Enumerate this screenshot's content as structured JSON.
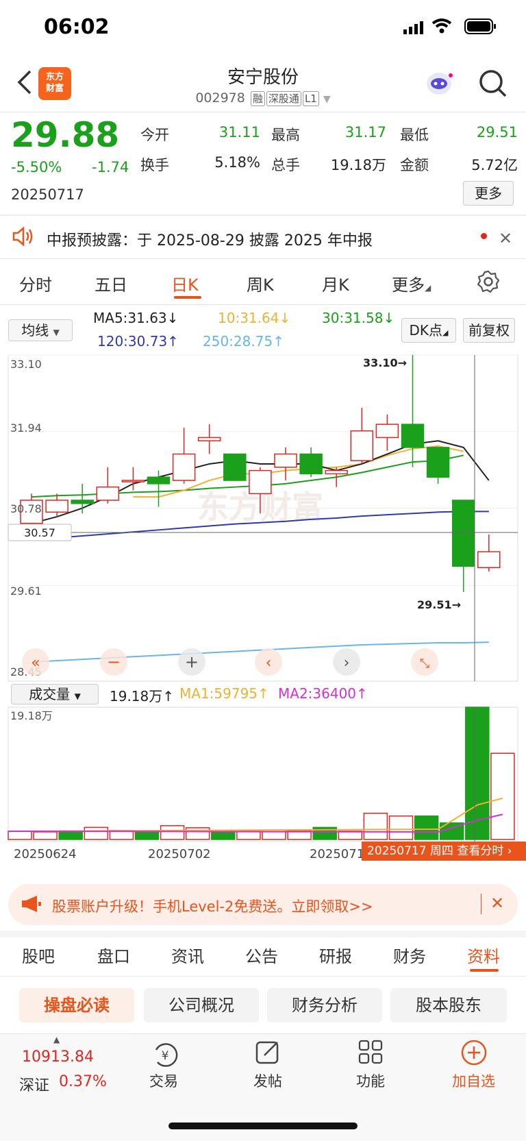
{
  "status_bar": {
    "time": "06:02"
  },
  "header": {
    "logo_text_1": "东方",
    "logo_text_2": "财富",
    "stock_name": "安宁股份",
    "code": "002978",
    "tags": [
      "融",
      "深股通",
      "L1"
    ]
  },
  "quote": {
    "price": "29.88",
    "change_pct": "-5.50%",
    "change": "-1.74",
    "date": "20250717",
    "open_label": "今开",
    "open": "31.11",
    "high_label": "最高",
    "high": "31.17",
    "low_label": "最低",
    "low": "29.51",
    "turnover_label": "换手",
    "turnover": "5.18%",
    "volume_label": "总手",
    "volume": "19.18万",
    "amount_label": "金额",
    "amount": "5.72亿",
    "more_label": "更多"
  },
  "notice": {
    "text": "中报预披露：于 2025-08-29 披露 2025 年中报"
  },
  "period_tabs": [
    "分时",
    "五日",
    "日K",
    "周K",
    "月K",
    "更多"
  ],
  "active_period": "日K",
  "indicators": {
    "ma_select": "均线",
    "ma5": "MA5:31.63↓",
    "ma10": "10:31.64↓",
    "ma30": "30:31.58↓",
    "ma120": "120:30.73↑",
    "ma250": "250:28.75↑",
    "dk_label": "DK点",
    "adjust_label": "前复权"
  },
  "price_axis": [
    "33.10",
    "31.94",
    "30.78",
    "29.61",
    "28.45"
  ],
  "crosshair_price": "30.57",
  "high_marker": "33.10→",
  "low_marker": "29.51→",
  "watermark": "东方财富",
  "volume_panel": {
    "select": "成交量",
    "value": "19.18万↑",
    "ma1": "MA1:59795↑",
    "ma2": "MA2:36400↑",
    "axis_top": "19.18万"
  },
  "date_axis": [
    "20250624",
    "20250702",
    "20250710"
  ],
  "tooltip": "20250717 周四  查看分时",
  "colors": {
    "up": "#e0261f",
    "down": "#1aa01a",
    "accent": "#e8541c"
  },
  "chart_data": {
    "type": "candlestick",
    "ylim": [
      28.45,
      33.1
    ],
    "candles": [
      {
        "o": 30.55,
        "c": 30.9,
        "h": 31.0,
        "l": 30.45
      },
      {
        "o": 30.72,
        "c": 30.9,
        "h": 31.0,
        "l": 30.65
      },
      {
        "o": 30.9,
        "c": 30.85,
        "h": 31.15,
        "l": 30.7
      },
      {
        "o": 30.9,
        "c": 31.1,
        "h": 31.4,
        "l": 30.85
      },
      {
        "o": 31.2,
        "c": 31.2,
        "h": 31.4,
        "l": 31.05
      },
      {
        "o": 31.25,
        "c": 31.15,
        "h": 31.35,
        "l": 30.8
      },
      {
        "o": 31.2,
        "c": 31.6,
        "h": 32.0,
        "l": 31.15
      },
      {
        "o": 31.8,
        "c": 31.85,
        "h": 32.05,
        "l": 31.6
      },
      {
        "o": 31.6,
        "c": 31.2,
        "h": 31.6,
        "l": 31.2
      },
      {
        "o": 31.0,
        "c": 31.35,
        "h": 31.4,
        "l": 30.7
      },
      {
        "o": 31.4,
        "c": 31.6,
        "h": 31.7,
        "l": 31.2
      },
      {
        "o": 31.6,
        "c": 31.3,
        "h": 31.7,
        "l": 31.25
      },
      {
        "o": 31.3,
        "c": 31.35,
        "h": 31.4,
        "l": 31.1
      },
      {
        "o": 31.5,
        "c": 31.95,
        "h": 32.3,
        "l": 31.45
      },
      {
        "o": 31.85,
        "c": 32.05,
        "h": 32.2,
        "l": 31.65
      },
      {
        "o": 32.05,
        "c": 31.7,
        "h": 33.1,
        "l": 31.4
      },
      {
        "o": 31.7,
        "c": 31.25,
        "h": 31.7,
        "l": 31.15
      },
      {
        "o": 30.9,
        "c": 29.9,
        "h": 30.9,
        "l": 29.51
      },
      {
        "o": 29.88,
        "c": 30.12,
        "h": 30.38,
        "l": 29.82
      }
    ],
    "ma5": [
      30.55,
      30.65,
      30.78,
      30.95,
      31.15,
      31.25,
      31.35,
      31.45,
      31.5,
      31.45,
      31.45,
      31.45,
      31.35,
      31.45,
      31.6,
      31.75,
      31.8,
      31.7,
      31.2
    ],
    "ma10": [
      null,
      null,
      null,
      null,
      30.95,
      30.95,
      31.05,
      31.2,
      31.3,
      31.3,
      31.35,
      31.38,
      31.4,
      31.45,
      31.58,
      31.68,
      31.72,
      31.64
    ],
    "ma30": [
      30.95,
      30.97,
      30.98,
      31.0,
      31.02,
      31.03,
      31.05,
      31.08,
      31.1,
      31.12,
      31.15,
      31.2,
      31.25,
      31.32,
      31.4,
      31.48,
      31.5,
      31.58
    ],
    "ma120": [
      30.3,
      30.33,
      30.36,
      30.39,
      30.42,
      30.45,
      30.48,
      30.51,
      30.54,
      30.56,
      30.58,
      30.61,
      30.63,
      30.66,
      30.68,
      30.7,
      30.72,
      30.73,
      30.73
    ],
    "ma250": [
      28.45,
      28.47,
      28.49,
      28.51,
      28.53,
      28.55,
      28.57,
      28.59,
      28.61,
      28.63,
      28.65,
      28.67,
      28.69,
      28.71,
      28.72,
      28.73,
      28.74,
      28.74,
      28.75
    ],
    "volume_max": 191800,
    "volumes": [
      12000,
      11000,
      12500,
      17500,
      13000,
      12000,
      20000,
      17000,
      13000,
      12000,
      13500,
      13000,
      17500,
      12000,
      38000,
      34000,
      34000,
      24000,
      191800,
      125000
    ],
    "vol_ma1": [
      null,
      null,
      null,
      null,
      null,
      null,
      null,
      null,
      null,
      null,
      null,
      null,
      null,
      null,
      null,
      null,
      null,
      null,
      50000,
      59795
    ],
    "vol_ma2": [
      null,
      null,
      null,
      null,
      null,
      null,
      null,
      null,
      null,
      null,
      null,
      null,
      null,
      null,
      null,
      null,
      null,
      null,
      28000,
      36400
    ]
  },
  "promo": {
    "text": "股票账户升级！手机Level-2免费送。立即领取>>"
  },
  "section_tabs": [
    "股吧",
    "盘口",
    "资讯",
    "公告",
    "研报",
    "财务",
    "资料"
  ],
  "active_section": "资料",
  "sub_tabs": [
    "操盘必读",
    "公司概况",
    "财务分析",
    "股本股东"
  ],
  "bottom_bar": {
    "index_value": "10913.84",
    "index_name": "深证",
    "index_change": "0.37%",
    "trade": "交易",
    "post": "发帖",
    "function": "功能",
    "add": "加自选"
  }
}
